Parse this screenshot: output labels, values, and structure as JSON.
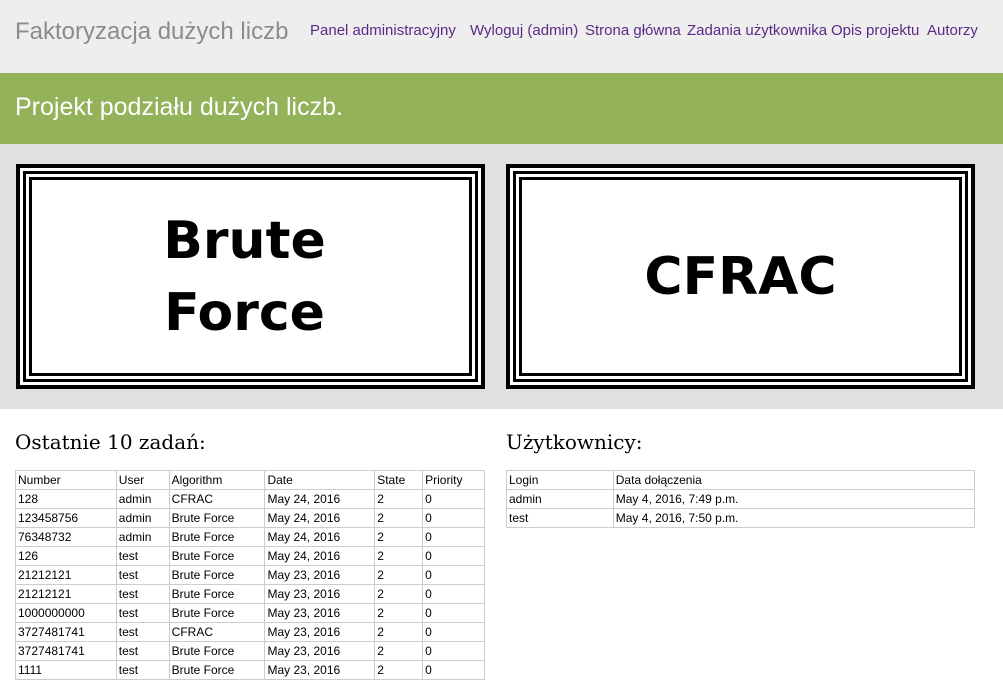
{
  "header": {
    "brand": "Faktoryzacja dużych liczb",
    "nav": [
      {
        "label": "Panel administracyjny"
      },
      {
        "label": "Wyloguj (admin)"
      },
      {
        "label": "Strona główna"
      },
      {
        "label": "Zadania użytkownika"
      },
      {
        "label": "Opis projektu"
      },
      {
        "label": "Autorzy"
      }
    ]
  },
  "banner": {
    "title": "Projekt podziału dużych liczb."
  },
  "algorithms": [
    {
      "line1": "Brute",
      "line2": "Force"
    },
    {
      "line1": "CFRAC"
    }
  ],
  "tasks": {
    "title": "Ostatnie 10 zadań:",
    "columns": [
      "Number",
      "User",
      "Algorithm",
      "Date",
      "State",
      "Priority"
    ],
    "rows": [
      [
        "128",
        "admin",
        "CFRAC",
        "May 24, 2016",
        "2",
        "0"
      ],
      [
        "123458756",
        "admin",
        "Brute Force",
        "May 24, 2016",
        "2",
        "0"
      ],
      [
        "76348732",
        "admin",
        "Brute Force",
        "May 24, 2016",
        "2",
        "0"
      ],
      [
        "126",
        "test",
        "Brute Force",
        "May 24, 2016",
        "2",
        "0"
      ],
      [
        "21212121",
        "test",
        "Brute Force",
        "May 23, 2016",
        "2",
        "0"
      ],
      [
        "21212121",
        "test",
        "Brute Force",
        "May 23, 2016",
        "2",
        "0"
      ],
      [
        "1000000000",
        "test",
        "Brute Force",
        "May 23, 2016",
        "2",
        "0"
      ],
      [
        "3727481741",
        "test",
        "CFRAC",
        "May 23, 2016",
        "2",
        "0"
      ],
      [
        "3727481741",
        "test",
        "Brute Force",
        "May 23, 2016",
        "2",
        "0"
      ],
      [
        "1111",
        "test",
        "Brute Force",
        "May 23, 2016",
        "2",
        "0"
      ]
    ]
  },
  "users": {
    "title": "Użytkownicy:",
    "columns": [
      "Login",
      "Data dołączenia"
    ],
    "rows": [
      [
        "admin",
        "May 4, 2016, 7:49 p.m."
      ],
      [
        "test",
        "May 4, 2016, 7:50 p.m."
      ]
    ]
  }
}
